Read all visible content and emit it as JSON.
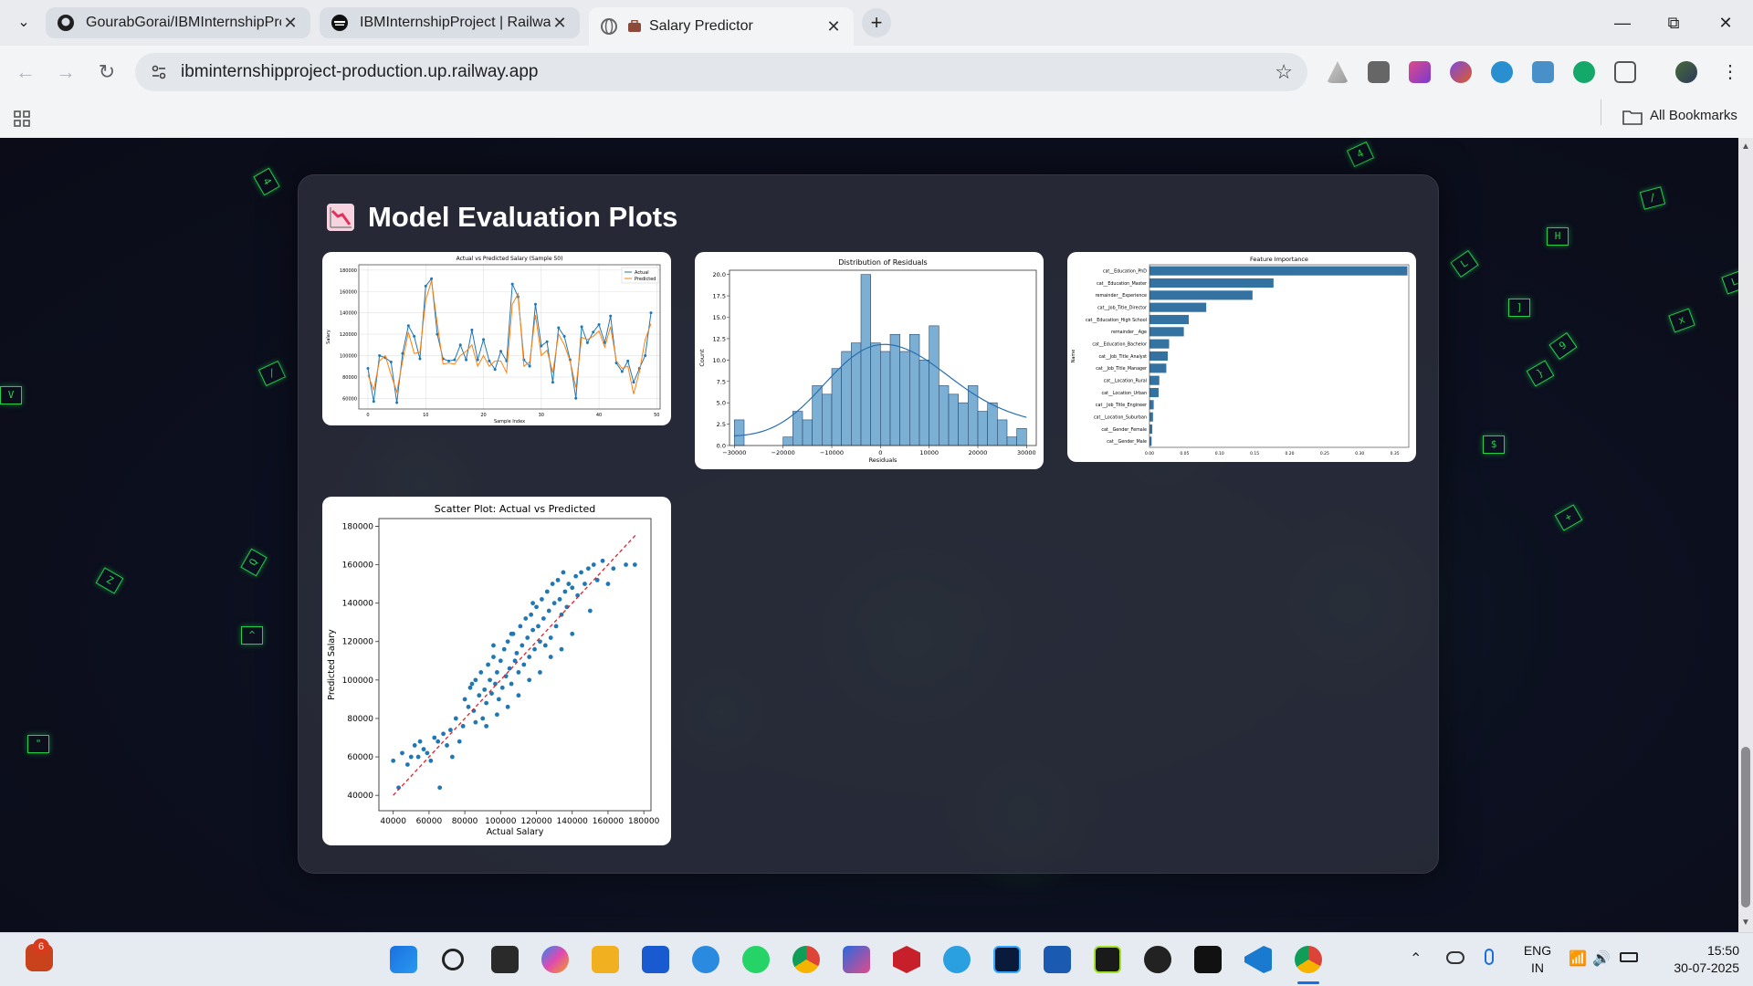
{
  "browser": {
    "tabs": [
      {
        "title": "GourabGorai/IBMInternshipProj"
      },
      {
        "title": "IBMInternshipProject | Railway"
      },
      {
        "title": "Salary Predictor"
      }
    ],
    "url": "ibminternshipproject-production.up.railway.app",
    "all_bookmarks": "All Bookmarks"
  },
  "page": {
    "title": "Model Evaluation Plots",
    "title_icon": "chart-decreasing-icon",
    "glyphs": [
      "4",
      "/",
      "V",
      "Z",
      "Q",
      "^",
      "\"",
      "7",
      "]",
      "H",
      "L",
      "/",
      "x",
      "$",
      "9",
      "4",
      "+",
      "L",
      "}"
    ]
  },
  "chart_data": [
    {
      "type": "line",
      "title": "Actual vs Predicted Salary (Sample 50)",
      "xlabel": "Sample Index",
      "ylabel": "Salary",
      "xlim": [
        0,
        49
      ],
      "ylim": [
        50000,
        185000
      ],
      "xticks": [
        "0",
        "10",
        "20",
        "30",
        "40",
        "50"
      ],
      "yticks": [
        "60000",
        "80000",
        "100000",
        "120000",
        "140000",
        "160000",
        "180000"
      ],
      "legend": "top-right",
      "series": [
        {
          "name": "Actual",
          "color": "#1f77b4",
          "values": [
            88000,
            57000,
            100000,
            98000,
            94000,
            56000,
            102000,
            128000,
            118000,
            97000,
            165000,
            172000,
            120000,
            97000,
            95000,
            96000,
            110000,
            96000,
            124000,
            96000,
            115000,
            95000,
            87000,
            104000,
            95000,
            167000,
            155000,
            96000,
            90000,
            148000,
            109000,
            113000,
            75000,
            126000,
            118000,
            96000,
            60000,
            127000,
            112000,
            122000,
            129000,
            112000,
            137000,
            93000,
            85000,
            95000,
            75000,
            88000,
            100000,
            140000
          ]
        },
        {
          "name": "Predicted",
          "color": "#ff7f0e",
          "values": [
            82000,
            68000,
            95000,
            100000,
            82000,
            66000,
            95000,
            122000,
            102000,
            103000,
            152000,
            170000,
            130000,
            92000,
            93000,
            92000,
            100000,
            104000,
            110000,
            90000,
            100000,
            90000,
            95000,
            95000,
            84000,
            148000,
            158000,
            90000,
            94000,
            138000,
            100000,
            105000,
            84000,
            120000,
            110000,
            95000,
            70000,
            117000,
            115000,
            118000,
            123000,
            108000,
            127000,
            95000,
            88000,
            90000,
            64000,
            85000,
            115000,
            130000
          ]
        }
      ]
    },
    {
      "type": "bar",
      "title": "Distribution of Residuals",
      "xlabel": "Residuals",
      "ylabel": "Count",
      "xlim": [
        -31000,
        32000
      ],
      "ylim": [
        0,
        20.5
      ],
      "xticks": [
        "−30000",
        "−20000",
        "−10000",
        "0",
        "10000",
        "20000",
        "30000"
      ],
      "yticks": [
        "0.0",
        "2.5",
        "5.0",
        "7.5",
        "10.0",
        "12.5",
        "15.0",
        "17.5",
        "20.0"
      ],
      "bin_edges": [
        -30000,
        -28000,
        -26000,
        -24000,
        -22000,
        -20000,
        -18000,
        -16000,
        -14000,
        -12000,
        -10000,
        -8000,
        -6000,
        -4000,
        -2000,
        0,
        2000,
        4000,
        6000,
        8000,
        10000,
        12000,
        14000,
        16000,
        18000,
        20000,
        22000,
        24000,
        26000,
        28000,
        30000
      ],
      "counts": [
        3,
        0,
        0,
        0,
        0,
        1,
        4,
        3,
        7,
        6,
        9,
        11,
        12,
        20,
        12,
        11,
        13,
        11,
        13,
        10,
        14,
        7,
        6,
        5,
        7,
        4,
        5,
        3,
        1,
        2
      ],
      "kde": true
    },
    {
      "type": "bar",
      "orientation": "horizontal",
      "title": "Feature Importance",
      "ylabel": "Name",
      "xlim": [
        0,
        0.37
      ],
      "xticks": [
        "0.00",
        "0.05",
        "0.10",
        "0.15",
        "0.20",
        "0.25",
        "0.30",
        "0.35"
      ],
      "categories": [
        "cat__Education_PhD",
        "cat__Education_Master",
        "remainder__Experience",
        "cat__Job_Title_Director",
        "cat__Education_High School",
        "remainder__Age",
        "cat__Education_Bachelor",
        "cat__Job_Title_Analyst",
        "cat__Job_Title_Manager",
        "cat__Location_Rural",
        "cat__Location_Urban",
        "cat__Job_Title_Engineer",
        "cat__Location_Suburban",
        "cat__Gender_Female",
        "cat__Gender_Male"
      ],
      "values": [
        0.368,
        0.177,
        0.147,
        0.081,
        0.056,
        0.049,
        0.028,
        0.026,
        0.024,
        0.014,
        0.013,
        0.006,
        0.005,
        0.004,
        0.003
      ]
    },
    {
      "type": "scatter",
      "title": "Scatter Plot: Actual vs Predicted",
      "xlabel": "Actual Salary",
      "ylabel": "Predicted Salary",
      "xlim": [
        32000,
        184000
      ],
      "ylim": [
        32000,
        184000
      ],
      "xticks": [
        "40000",
        "60000",
        "80000",
        "100000",
        "120000",
        "140000",
        "160000",
        "180000"
      ],
      "yticks": [
        "40000",
        "60000",
        "80000",
        "100000",
        "120000",
        "140000",
        "160000",
        "180000"
      ],
      "reference_line": "y = x",
      "points": [
        [
          40000,
          58000
        ],
        [
          43000,
          44000
        ],
        [
          45000,
          62000
        ],
        [
          48000,
          56000
        ],
        [
          50000,
          60000
        ],
        [
          52000,
          66000
        ],
        [
          54000,
          60000
        ],
        [
          55000,
          68000
        ],
        [
          57000,
          64000
        ],
        [
          59000,
          62000
        ],
        [
          61000,
          58000
        ],
        [
          63000,
          70000
        ],
        [
          65000,
          68000
        ],
        [
          66000,
          44000
        ],
        [
          68000,
          72000
        ],
        [
          70000,
          66000
        ],
        [
          72000,
          74000
        ],
        [
          73000,
          60000
        ],
        [
          75000,
          80000
        ],
        [
          77000,
          68000
        ],
        [
          79000,
          76000
        ],
        [
          80000,
          90000
        ],
        [
          82000,
          86000
        ],
        [
          83000,
          96000
        ],
        [
          85000,
          84000
        ],
        [
          86000,
          100000
        ],
        [
          88000,
          92000
        ],
        [
          89000,
          104000
        ],
        [
          90000,
          80000
        ],
        [
          91000,
          95000
        ],
        [
          92000,
          88000
        ],
        [
          93000,
          108000
        ],
        [
          94000,
          100000
        ],
        [
          95000,
          93000
        ],
        [
          96000,
          112000
        ],
        [
          97000,
          98000
        ],
        [
          98000,
          104000
        ],
        [
          99000,
          90000
        ],
        [
          100000,
          110000
        ],
        [
          101000,
          96000
        ],
        [
          102000,
          116000
        ],
        [
          103000,
          102000
        ],
        [
          104000,
          120000
        ],
        [
          105000,
          106000
        ],
        [
          106000,
          98000
        ],
        [
          107000,
          124000
        ],
        [
          108000,
          110000
        ],
        [
          109000,
          114000
        ],
        [
          110000,
          104000
        ],
        [
          111000,
          128000
        ],
        [
          112000,
          118000
        ],
        [
          113000,
          108000
        ],
        [
          114000,
          132000
        ],
        [
          115000,
          122000
        ],
        [
          116000,
          112000
        ],
        [
          117000,
          134000
        ],
        [
          118000,
          126000
        ],
        [
          119000,
          116000
        ],
        [
          120000,
          138000
        ],
        [
          121000,
          128000
        ],
        [
          122000,
          120000
        ],
        [
          123000,
          142000
        ],
        [
          124000,
          132000
        ],
        [
          125000,
          118000
        ],
        [
          126000,
          146000
        ],
        [
          127000,
          136000
        ],
        [
          128000,
          122000
        ],
        [
          129000,
          150000
        ],
        [
          130000,
          140000
        ],
        [
          131000,
          128000
        ],
        [
          132000,
          152000
        ],
        [
          133000,
          142000
        ],
        [
          134000,
          134000
        ],
        [
          135000,
          156000
        ],
        [
          136000,
          146000
        ],
        [
          137000,
          138000
        ],
        [
          138000,
          150000
        ],
        [
          140000,
          148000
        ],
        [
          142000,
          154000
        ],
        [
          143000,
          144000
        ],
        [
          145000,
          156000
        ],
        [
          147000,
          150000
        ],
        [
          149000,
          158000
        ],
        [
          150000,
          136000
        ],
        [
          152000,
          160000
        ],
        [
          154000,
          152000
        ],
        [
          157000,
          162000
        ],
        [
          160000,
          150000
        ],
        [
          163000,
          158000
        ],
        [
          170000,
          160000
        ],
        [
          175000,
          160000
        ],
        [
          86000,
          78000
        ],
        [
          92000,
          76000
        ],
        [
          98000,
          82000
        ],
        [
          104000,
          86000
        ],
        [
          110000,
          92000
        ],
        [
          116000,
          100000
        ],
        [
          122000,
          104000
        ],
        [
          128000,
          112000
        ],
        [
          134000,
          116000
        ],
        [
          140000,
          124000
        ],
        [
          84000,
          98000
        ],
        [
          96000,
          118000
        ],
        [
          106000,
          124000
        ],
        [
          118000,
          140000
        ]
      ]
    }
  ],
  "taskbar": {
    "badge_count": "6",
    "language": "ENG",
    "region": "IN",
    "time": "15:50",
    "date": "30-07-2025"
  }
}
